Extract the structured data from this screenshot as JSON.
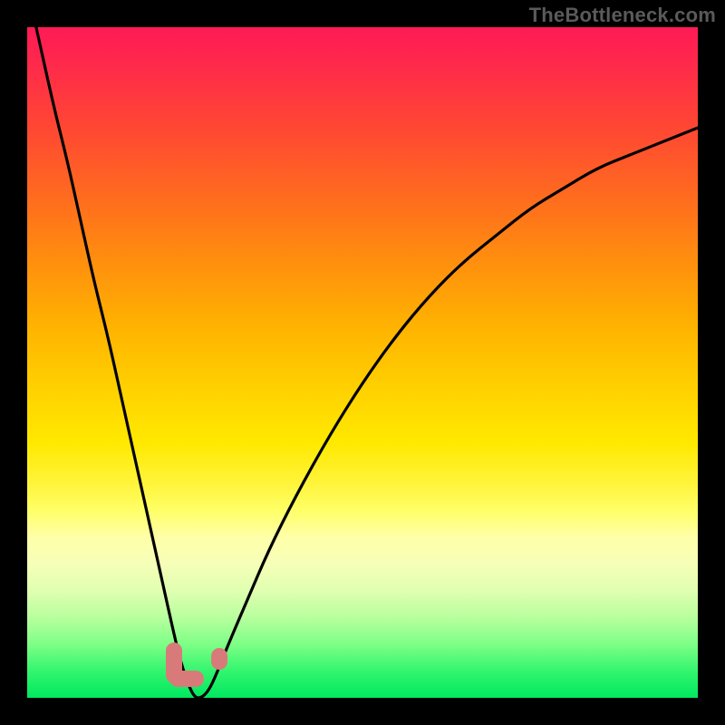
{
  "watermark": "TheBottleneck.com",
  "colors": {
    "frame": "#000000",
    "curve": "#000000",
    "marker": "#d97a7a",
    "gradient_top": "#ff1a55",
    "gradient_bottom": "#00e85f"
  },
  "chart_data": {
    "type": "line",
    "title": "",
    "xlabel": "",
    "ylabel": "",
    "xlim": [
      0,
      100
    ],
    "ylim": [
      0,
      100
    ],
    "grid": false,
    "legend": false,
    "series": [
      {
        "name": "bottleneck-curve",
        "x": [
          0,
          2,
          4,
          6,
          8,
          10,
          12,
          14,
          16,
          18,
          20,
          22,
          23,
          24,
          25,
          26,
          27,
          28,
          30,
          33,
          36,
          40,
          45,
          50,
          55,
          60,
          65,
          70,
          75,
          80,
          85,
          90,
          95,
          100
        ],
        "y": [
          106,
          97,
          88,
          80,
          71,
          62,
          54,
          45,
          36,
          27,
          18,
          9,
          5,
          2,
          0,
          0,
          1,
          3,
          8,
          15,
          22,
          30,
          39,
          47,
          54,
          60,
          65,
          69,
          73,
          76,
          79,
          81,
          83,
          85
        ]
      }
    ],
    "annotations": [
      {
        "name": "marker-l-left",
        "x": 21.5,
        "y": 3.5,
        "shape": "pill",
        "orientation": "vertical"
      },
      {
        "name": "marker-l-bottom",
        "x": 23.5,
        "y": 0.8,
        "shape": "pill",
        "orientation": "horizontal"
      },
      {
        "name": "marker-dot",
        "x": 28.2,
        "y": 3.5,
        "shape": "dot"
      }
    ]
  }
}
